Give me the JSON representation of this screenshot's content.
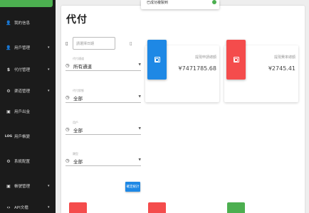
{
  "colors": {
    "sidebar_bg": "#1b1b1b",
    "sidebar_active": "#4caf50",
    "accent_blue": "#1e88e5",
    "accent_red": "#f44c4c",
    "accent_green": "#4caf50"
  },
  "toast": {
    "text": "已成功複製到"
  },
  "sidebar": {
    "items": [
      {
        "label": "我的信息",
        "icon": "user-icon",
        "glyph": "👤",
        "caret": ""
      },
      {
        "label": "用戶管理",
        "icon": "user-icon",
        "glyph": "👤",
        "caret": "▾"
      },
      {
        "label": "代付管理",
        "icon": "dollar-icon",
        "glyph": "$",
        "caret": "▾"
      },
      {
        "label": "渠道管理",
        "icon": "gear-icon",
        "glyph": "⚙",
        "caret": "▾"
      },
      {
        "label": "用戶出金",
        "icon": "money-icon",
        "glyph": "▣",
        "caret": ""
      },
      {
        "label": "用戶帳變",
        "icon": "log-icon",
        "glyph": "LOG",
        "caret": ""
      },
      {
        "label": "系統配置",
        "icon": "settings-icon",
        "glyph": "⚙",
        "caret": ""
      },
      {
        "label": "帳號管理",
        "icon": "account-icon",
        "glyph": "▣",
        "caret": "▾"
      },
      {
        "label": "API文檔",
        "icon": "code-icon",
        "glyph": "‹›",
        "caret": "▾"
      }
    ]
  },
  "page": {
    "title": "代付"
  },
  "form": {
    "date_placeholder": "請選擇日期",
    "fields": [
      {
        "label": "代付通道",
        "value": "所有通道"
      },
      {
        "label": "代付狀態",
        "value": "全部"
      },
      {
        "label": "用戶",
        "value": "全部"
      },
      {
        "label": "類型",
        "value": "全部"
      }
    ],
    "submit_label": "確定統計"
  },
  "stats": [
    {
      "label": "提現申請總額",
      "value": "¥7471785.68",
      "color": "#1e88e5"
    },
    {
      "label": "提現費率總額",
      "value": "¥2745.41",
      "color": "#f44c4c"
    }
  ]
}
